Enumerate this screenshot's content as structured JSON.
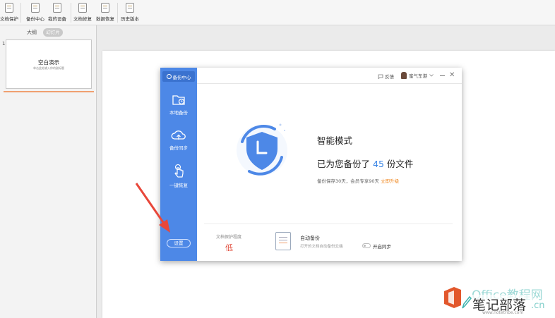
{
  "ribbon": {
    "buttons": [
      {
        "label": "文档保护",
        "icon": "document-protect-icon"
      },
      {
        "label": "备份中心",
        "icon": "backup-center-icon"
      },
      {
        "label": "我的设备",
        "icon": "my-devices-icon"
      },
      {
        "label": "文档修复",
        "icon": "document-repair-icon"
      },
      {
        "label": "数据恢复",
        "icon": "data-recovery-icon"
      },
      {
        "label": "历史版本",
        "icon": "history-versions-icon"
      }
    ]
  },
  "thumbnail_pane": {
    "tab_outline": "大纲",
    "tab_slides": "幻灯片",
    "slide_number": "1",
    "slide_title": "空白演示",
    "slide_subtitle": "单击此处输入你的副标题"
  },
  "dialog": {
    "brand_label": "备份中心",
    "nav": [
      {
        "label": "本地备份",
        "icon": "folder-clock-icon"
      },
      {
        "label": "备份同步",
        "icon": "cloud-upload-icon"
      },
      {
        "label": "一键恢复",
        "icon": "hand-tap-icon"
      }
    ],
    "settings_label": "设置",
    "feedback_label": "反馈",
    "user_name": "蜜气东港",
    "mode_title": "智能模式",
    "backup_prefix": "已为您备份了",
    "backup_count": "45",
    "backup_suffix": "份文件",
    "quota_text": "备份保存30天，会员专享90天",
    "upgrade_link": "立即升级",
    "protection_label": "文档保护程度",
    "protection_value": "低",
    "auto_backup_title": "自动备份",
    "auto_backup_desc": "打开的文档自动备份云端",
    "sync_label": "开启同步"
  },
  "watermark": {
    "brand": "Office教程网",
    "title": "笔记部落",
    "suffix": ".cn",
    "url": "www.notetribe.com"
  },
  "colors": {
    "sidebar": "#4d88e7",
    "accent": "#3b86e6",
    "arrow": "#e8473a",
    "protection": "#e04a3a"
  }
}
